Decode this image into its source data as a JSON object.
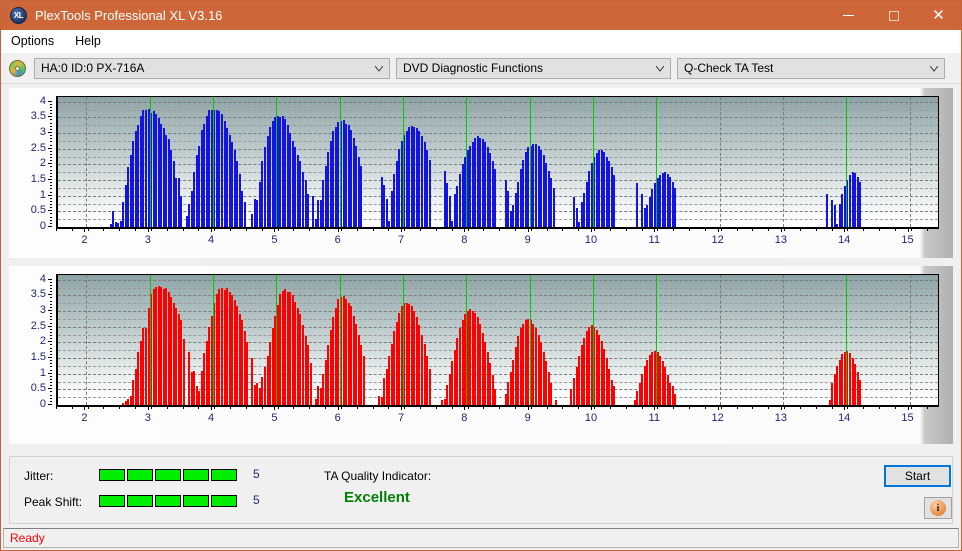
{
  "window": {
    "title": "PlexTools Professional XL V3.16",
    "icon": "XL",
    "buttons": {
      "minimize": "minimize-icon",
      "maximize": "maximize-icon",
      "close": "close-icon"
    }
  },
  "menubar": {
    "items": [
      {
        "label": "Options"
      },
      {
        "label": "Help"
      }
    ]
  },
  "toolbar": {
    "drive_icon": "disc-icon",
    "drive": "HA:0 ID:0  PX-716A",
    "function_group": "DVD Diagnostic Functions",
    "test": "Q-Check TA Test"
  },
  "results": {
    "jitter_label": "Jitter:",
    "jitter_value": "5",
    "jitter_segments": 5,
    "peak_shift_label": "Peak Shift:",
    "peak_shift_value": "5",
    "peak_shift_segments": 5,
    "ta_quality_label": "TA Quality Indicator:",
    "ta_quality_value": "Excellent",
    "ta_quality_color": "#008000",
    "start_label": "Start",
    "info_icon": "info-icon"
  },
  "statusbar": {
    "text": "Ready"
  },
  "chart_data": [
    {
      "id": "chart-jitter",
      "type": "bar",
      "title": "",
      "color": "#1414e1",
      "marker_color": "#00cc00",
      "xlabel": "",
      "ylabel": "",
      "xlim": [
        1.55,
        15.45
      ],
      "ylim": [
        0,
        4.15
      ],
      "grid": true,
      "xticks": [
        2,
        3,
        4,
        5,
        6,
        7,
        8,
        9,
        10,
        11,
        12,
        13,
        14,
        15
      ],
      "xticklabels": [
        "2",
        "3",
        "4",
        "5",
        "6",
        "7",
        "8",
        "9",
        "10",
        "11",
        "12",
        "13",
        "14",
        "15"
      ],
      "yticks": [
        0,
        0.5,
        1,
        1.5,
        2,
        2.5,
        3,
        3.5,
        4
      ],
      "yticklabels": [
        "0",
        "0.5",
        "1",
        "1.5",
        "2",
        "2.5",
        "3",
        "3.5",
        "4"
      ],
      "markers": [
        3,
        4,
        5,
        6,
        7,
        8,
        9,
        10,
        11,
        14
      ],
      "bar_width": 0.022,
      "x": [
        2.38,
        2.42,
        2.46,
        2.5,
        2.54,
        2.58,
        2.62,
        2.66,
        2.7,
        2.74,
        2.78,
        2.82,
        2.86,
        2.9,
        2.94,
        2.98,
        3.02,
        3.06,
        3.1,
        3.14,
        3.18,
        3.22,
        3.26,
        3.3,
        3.34,
        3.38,
        3.42,
        3.46,
        3.5,
        3.58,
        3.62,
        3.66,
        3.7,
        3.74,
        3.78,
        3.82,
        3.86,
        3.9,
        3.94,
        3.98,
        4.02,
        4.06,
        4.1,
        4.14,
        4.18,
        4.22,
        4.26,
        4.3,
        4.34,
        4.38,
        4.42,
        4.46,
        4.5,
        4.62,
        4.66,
        4.7,
        4.74,
        4.78,
        4.82,
        4.86,
        4.9,
        4.94,
        4.98,
        5.02,
        5.06,
        5.1,
        5.14,
        5.18,
        5.22,
        5.26,
        5.3,
        5.34,
        5.38,
        5.42,
        5.46,
        5.5,
        5.58,
        5.62,
        5.66,
        5.7,
        5.74,
        5.78,
        5.82,
        5.86,
        5.9,
        5.94,
        5.98,
        6.02,
        6.06,
        6.1,
        6.14,
        6.18,
        6.22,
        6.26,
        6.3,
        6.34,
        6.66,
        6.7,
        6.74,
        6.78,
        6.82,
        6.86,
        6.9,
        6.94,
        6.98,
        7.02,
        7.06,
        7.1,
        7.14,
        7.18,
        7.22,
        7.26,
        7.3,
        7.34,
        7.38,
        7.42,
        7.66,
        7.7,
        7.74,
        7.78,
        7.82,
        7.86,
        7.9,
        7.94,
        7.98,
        8.02,
        8.06,
        8.1,
        8.14,
        8.18,
        8.22,
        8.26,
        8.3,
        8.34,
        8.38,
        8.42,
        8.46,
        8.62,
        8.66,
        8.7,
        8.74,
        8.78,
        8.82,
        8.86,
        8.9,
        8.94,
        8.98,
        9.02,
        9.06,
        9.1,
        9.14,
        9.18,
        9.22,
        9.26,
        9.3,
        9.34,
        9.38,
        9.7,
        9.74,
        9.78,
        9.82,
        9.86,
        9.9,
        9.94,
        9.98,
        10.02,
        10.06,
        10.1,
        10.14,
        10.18,
        10.22,
        10.26,
        10.3,
        10.34,
        10.7,
        10.78,
        10.82,
        10.86,
        10.9,
        10.94,
        10.98,
        11.02,
        11.06,
        11.1,
        11.14,
        11.18,
        11.22,
        11.26,
        11.3,
        13.7,
        13.78,
        13.82,
        13.86,
        13.9,
        13.94,
        13.98,
        14.02,
        14.06,
        14.1,
        14.14,
        14.18,
        14.22
      ],
      "values": [
        0.1,
        0.5,
        0.15,
        0.12,
        0.2,
        0.8,
        1.35,
        1.9,
        2.3,
        2.75,
        3.05,
        3.25,
        3.55,
        3.72,
        3.75,
        3.78,
        3.65,
        3.7,
        3.6,
        3.48,
        3.3,
        3.15,
        2.95,
        2.8,
        2.45,
        2.1,
        1.55,
        1.55,
        1.0,
        0.35,
        0.75,
        1.15,
        1.75,
        2.3,
        2.6,
        3.1,
        3.3,
        3.55,
        3.72,
        3.75,
        3.72,
        3.72,
        3.7,
        3.6,
        3.4,
        3.15,
        2.95,
        2.7,
        2.45,
        2.1,
        1.7,
        1.15,
        0.8,
        0.4,
        0.9,
        0.85,
        1.45,
        2.1,
        2.55,
        2.9,
        3.2,
        3.4,
        3.5,
        3.55,
        3.52,
        3.55,
        3.45,
        3.25,
        3.0,
        2.75,
        2.55,
        2.3,
        2.1,
        1.75,
        1.5,
        1.05,
        1.0,
        0.25,
        0.85,
        0.85,
        1.5,
        1.95,
        2.4,
        2.75,
        3.05,
        3.2,
        3.35,
        3.4,
        3.42,
        3.3,
        3.25,
        3.1,
        2.85,
        2.6,
        2.25,
        1.95,
        1.6,
        1.35,
        0.9,
        0.2,
        1.15,
        1.7,
        2.1,
        2.5,
        2.75,
        2.95,
        3.05,
        3.2,
        3.22,
        3.2,
        3.15,
        3.05,
        2.9,
        2.7,
        2.45,
        2.15,
        1.8,
        1.4,
        1.0,
        0.2,
        1.05,
        1.3,
        1.7,
        2.0,
        2.25,
        2.45,
        2.6,
        2.7,
        2.85,
        2.9,
        2.85,
        2.8,
        2.7,
        2.55,
        2.35,
        2.1,
        1.85,
        1.5,
        1.15,
        0.5,
        0.7,
        1.1,
        1.45,
        1.85,
        2.15,
        2.4,
        2.55,
        2.6,
        2.65,
        2.65,
        2.6,
        2.45,
        2.3,
        2.05,
        1.8,
        1.55,
        1.25,
        0.95,
        0.6,
        0.15,
        0.8,
        1.1,
        1.45,
        1.8,
        2.05,
        2.25,
        2.35,
        2.45,
        2.45,
        2.4,
        2.25,
        2.1,
        1.9,
        1.65,
        1.4,
        1.05,
        0.6,
        0.7,
        0.95,
        1.2,
        1.4,
        1.55,
        1.65,
        1.72,
        1.75,
        1.7,
        1.6,
        1.45,
        1.25,
        1.05,
        0.85,
        0.7,
        0.1,
        0.75,
        1.05,
        1.3,
        1.5,
        1.65,
        1.75,
        1.72,
        1.6,
        1.45,
        1.25,
        1.0,
        0.75
      ]
    },
    {
      "id": "chart-peak-shift",
      "type": "bar",
      "title": "",
      "color": "#ff0000",
      "marker_color": "#00cc00",
      "xlabel": "",
      "ylabel": "",
      "xlim": [
        1.55,
        15.45
      ],
      "ylim": [
        0,
        4.15
      ],
      "grid": true,
      "xticks": [
        2,
        3,
        4,
        5,
        6,
        7,
        8,
        9,
        10,
        11,
        12,
        13,
        14,
        15
      ],
      "xticklabels": [
        "2",
        "3",
        "4",
        "5",
        "6",
        "7",
        "8",
        "9",
        "10",
        "11",
        "12",
        "13",
        "14",
        "15"
      ],
      "yticks": [
        0,
        0.5,
        1,
        1.5,
        2,
        2.5,
        3,
        3.5,
        4
      ],
      "yticklabels": [
        "0",
        "0.5",
        "1",
        "1.5",
        "2",
        "2.5",
        "3",
        "3.5",
        "4"
      ],
      "markers": [
        3,
        4,
        5,
        6,
        7,
        8,
        9,
        10,
        11,
        14
      ],
      "bar_width": 0.022,
      "x": [
        2.58,
        2.62,
        2.66,
        2.7,
        2.74,
        2.78,
        2.82,
        2.86,
        2.9,
        2.94,
        2.98,
        3.02,
        3.06,
        3.1,
        3.14,
        3.18,
        3.22,
        3.26,
        3.3,
        3.34,
        3.38,
        3.42,
        3.46,
        3.5,
        3.54,
        3.62,
        3.66,
        3.7,
        3.74,
        3.78,
        3.82,
        3.86,
        3.9,
        3.94,
        3.98,
        4.02,
        4.06,
        4.1,
        4.14,
        4.18,
        4.22,
        4.26,
        4.3,
        4.34,
        4.38,
        4.42,
        4.46,
        4.5,
        4.54,
        4.62,
        4.66,
        4.7,
        4.74,
        4.78,
        4.82,
        4.86,
        4.9,
        4.94,
        4.98,
        5.02,
        5.06,
        5.1,
        5.14,
        5.18,
        5.22,
        5.26,
        5.3,
        5.34,
        5.38,
        5.42,
        5.46,
        5.5,
        5.54,
        5.62,
        5.66,
        5.7,
        5.74,
        5.78,
        5.82,
        5.86,
        5.9,
        5.94,
        5.98,
        6.02,
        6.06,
        6.1,
        6.14,
        6.18,
        6.22,
        6.26,
        6.3,
        6.34,
        6.38,
        6.62,
        6.66,
        6.7,
        6.74,
        6.78,
        6.82,
        6.86,
        6.9,
        6.94,
        6.98,
        7.02,
        7.06,
        7.1,
        7.14,
        7.18,
        7.22,
        7.26,
        7.3,
        7.34,
        7.38,
        7.42,
        7.62,
        7.66,
        7.7,
        7.74,
        7.78,
        7.82,
        7.86,
        7.9,
        7.94,
        7.98,
        8.02,
        8.06,
        8.1,
        8.14,
        8.18,
        8.22,
        8.26,
        8.3,
        8.34,
        8.38,
        8.42,
        8.46,
        8.62,
        8.66,
        8.7,
        8.74,
        8.78,
        8.82,
        8.86,
        8.9,
        8.94,
        8.98,
        9.02,
        9.06,
        9.1,
        9.14,
        9.18,
        9.22,
        9.26,
        9.3,
        9.34,
        9.42,
        9.66,
        9.7,
        9.74,
        9.78,
        9.82,
        9.86,
        9.9,
        9.94,
        9.98,
        10.02,
        10.06,
        10.1,
        10.14,
        10.18,
        10.22,
        10.26,
        10.3,
        10.34,
        10.66,
        10.7,
        10.74,
        10.78,
        10.82,
        10.86,
        10.9,
        10.94,
        10.98,
        11.02,
        11.06,
        11.1,
        11.14,
        11.18,
        11.22,
        11.26,
        11.3,
        13.74,
        13.78,
        13.82,
        13.86,
        13.9,
        13.94,
        13.98,
        14.02,
        14.06,
        14.1,
        14.14,
        14.18,
        14.22
      ],
      "values": [
        0.08,
        0.12,
        0.18,
        0.3,
        0.8,
        1.15,
        1.7,
        2.05,
        2.45,
        2.45,
        3.1,
        3.55,
        3.7,
        3.78,
        3.8,
        3.78,
        3.7,
        3.72,
        3.62,
        3.45,
        3.25,
        3.1,
        2.9,
        2.7,
        2.1,
        1.7,
        1.05,
        1.1,
        0.6,
        0.45,
        1.1,
        1.65,
        2.05,
        2.5,
        2.85,
        3.25,
        3.55,
        3.7,
        3.72,
        3.68,
        3.72,
        3.6,
        3.5,
        3.35,
        3.15,
        2.9,
        2.7,
        2.35,
        2.0,
        1.5,
        0.65,
        0.7,
        0.55,
        0.9,
        1.2,
        1.55,
        2.0,
        2.45,
        2.85,
        3.2,
        3.55,
        3.65,
        3.7,
        3.62,
        3.6,
        3.5,
        3.3,
        3.1,
        2.9,
        2.55,
        2.2,
        1.9,
        1.35,
        0.2,
        0.6,
        0.55,
        1.0,
        1.45,
        1.9,
        2.4,
        2.8,
        3.1,
        3.4,
        3.45,
        3.48,
        3.4,
        3.25,
        3.15,
        2.85,
        2.6,
        2.25,
        1.9,
        1.55,
        0.3,
        0.25,
        0.85,
        1.15,
        1.55,
        1.95,
        2.35,
        2.65,
        2.95,
        3.15,
        3.25,
        3.25,
        3.22,
        3.15,
        3.0,
        2.8,
        2.55,
        2.25,
        1.95,
        1.55,
        1.15,
        0.15,
        0.2,
        0.65,
        1.0,
        1.4,
        1.75,
        2.15,
        2.45,
        2.7,
        2.9,
        3.0,
        3.05,
        3.0,
        2.95,
        2.8,
        2.6,
        2.3,
        2.0,
        1.7,
        1.35,
        0.95,
        0.5,
        0.35,
        0.75,
        1.05,
        1.45,
        1.85,
        2.2,
        2.45,
        2.6,
        2.7,
        2.75,
        2.72,
        2.6,
        2.45,
        2.25,
        2.0,
        1.7,
        1.4,
        1.05,
        0.7,
        0.15,
        0.5,
        0.85,
        1.2,
        1.55,
        1.9,
        2.15,
        2.35,
        2.5,
        2.55,
        2.5,
        2.4,
        2.25,
        2.05,
        1.8,
        1.5,
        1.15,
        0.8,
        0.6,
        0.15,
        0.45,
        0.7,
        1.0,
        1.25,
        1.45,
        1.6,
        1.7,
        1.72,
        1.68,
        1.55,
        1.4,
        1.2,
        0.95,
        0.7,
        0.6,
        0.35,
        0.15,
        0.7,
        1.0,
        1.25,
        1.45,
        1.62,
        1.7,
        1.72,
        1.65,
        1.5,
        1.3,
        1.05,
        0.8
      ]
    }
  ]
}
